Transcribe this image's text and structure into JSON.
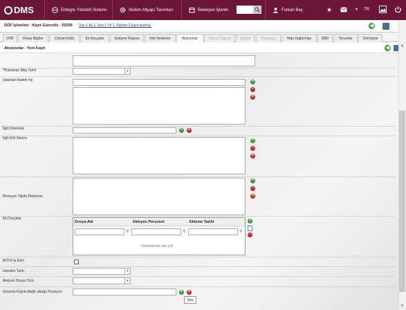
{
  "topbar": {
    "logo_text": "DMS",
    "items": [
      "Entegre Yönetim Sistemi",
      "Sistem Altyapı Tanımları",
      "Bekleyen İşlerim"
    ],
    "user": "Furkan Baş",
    "lang": "TR"
  },
  "subbar": {
    "title": "DÖF İşlemleri - Kayıt Güncelle - 02500",
    "filter_link": "Son 1 Ay 1, Son 1 Yıl 1, Toplam 2 kayıt açılmış."
  },
  "tabs": [
    "DÖF",
    "Detay Bilgiler",
    "Çözüm Ekibi",
    "Ek Dosyalar",
    "Gelişme Raporu",
    "Kök Nedenler",
    "Aksiyonlar",
    "Sonuç Raporu",
    "İzleme",
    "Kapatma",
    "Hata Dağılımları",
    "GBD",
    "Yorumlar",
    "Görüntüle"
  ],
  "active_tab": "Aksiyonlar",
  "panel": {
    "title": "Aksiyonlar - Yeni Kayıt"
  },
  "form": {
    "planned_end_date": "*Planlanan Bitiş Tarihi",
    "standard_clause": "Standart Madde No",
    "related_doc": "İlgili Doküman",
    "related_root": "İlgili Kök Neden",
    "revision_doc": "Revizyon Talebi Doküman",
    "attachments": "Ek Dosyalar",
    "boys": "BOYS İş Emri",
    "requested_date": "İstenilen Tarih",
    "action_file_type": "Aksiyon Dosya Türü",
    "responsible_position": "Sorumlu Kişinin Bağlı olduğu Pozisyon"
  },
  "attach_table": {
    "columns": [
      "Dosya Adı",
      "Ekleyen Personel",
      "Ekleme Tarihi"
    ],
    "empty_text": "Gösterilecek veri yok"
  },
  "tooltip": "Seç"
}
